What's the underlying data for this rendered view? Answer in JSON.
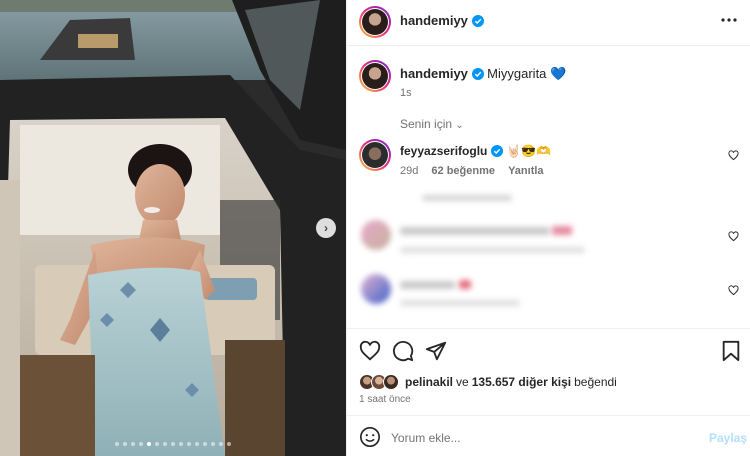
{
  "post": {
    "username": "handemiyy",
    "more_icon": "more-horizontal-icon",
    "caption_user": "handemiyy",
    "caption_text": "Miyygarita",
    "caption_emoji": "💙",
    "caption_time": "1s"
  },
  "comments": {
    "filter_label": "Senin için",
    "items": [
      {
        "username": "feyyazserifoglu",
        "text": "🤘🏻😎🫶",
        "time": "29d",
        "likes": "62 beğenme",
        "reply": "Yanıtla"
      }
    ]
  },
  "carousel": {
    "dot_count": 15,
    "active_index": 4
  },
  "actions": {
    "like_icon": "heart-icon",
    "comment_icon": "comment-icon",
    "share_icon": "send-icon",
    "save_icon": "bookmark-icon"
  },
  "likes": {
    "liked_by": "pelinakil",
    "connector": "ve",
    "count_text": "135.657 diğer kişi",
    "suffix": "beğendi"
  },
  "timestamp": "1 saat önce",
  "comment_box": {
    "placeholder": "Yorum ekle...",
    "post_label": "Paylaş"
  },
  "colors": {
    "verified": "#0095f6",
    "link": "#0095f6",
    "post_disabled": "#b2dffc"
  }
}
